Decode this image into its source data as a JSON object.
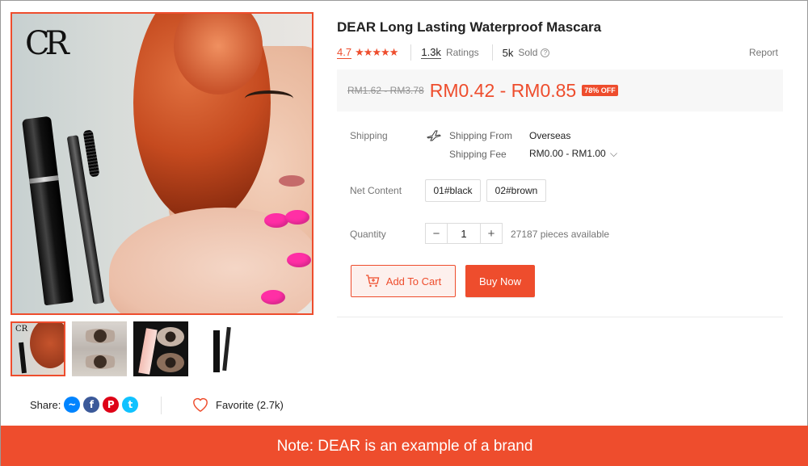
{
  "product": {
    "title": "DEAR Long Lasting Waterproof Mascara",
    "brand_logo": "CR",
    "rating": "4.7",
    "stars": "★★★★★",
    "ratings_count": "1.3k",
    "ratings_label": "Ratings",
    "sold_count": "5k",
    "sold_label": "Sold",
    "help_symbol": "?",
    "report_label": "Report"
  },
  "price": {
    "original": "RM1.62 - RM3.78",
    "current": "RM0.42 - RM0.85",
    "discount_badge": "78% OFF"
  },
  "shipping": {
    "label": "Shipping",
    "from_label": "Shipping From",
    "from_value": "Overseas",
    "fee_label": "Shipping Fee",
    "fee_value": "RM0.00 - RM1.00",
    "fee_chevron": "⌵"
  },
  "net_content": {
    "label": "Net Content",
    "options": [
      "01#black",
      "02#brown"
    ]
  },
  "quantity": {
    "label": "Quantity",
    "decrement": "−",
    "value": "1",
    "increment": "+",
    "available": "27187 pieces available"
  },
  "actions": {
    "add_to_cart": "Add To Cart",
    "buy_now": "Buy Now"
  },
  "share": {
    "label": "Share:",
    "networks": [
      "messenger",
      "facebook",
      "pinterest",
      "twitter"
    ],
    "icons": {
      "messenger": "~",
      "facebook": "f",
      "pinterest": "P",
      "twitter": "t"
    }
  },
  "favorite": {
    "label": "Favorite (2.7k)"
  },
  "footer": {
    "note": "Note: DEAR is an example of a brand"
  },
  "colors": {
    "accent": "#ee4d2d",
    "price_bg": "#f7f7f7",
    "note_bar": "#ee4d2d"
  }
}
